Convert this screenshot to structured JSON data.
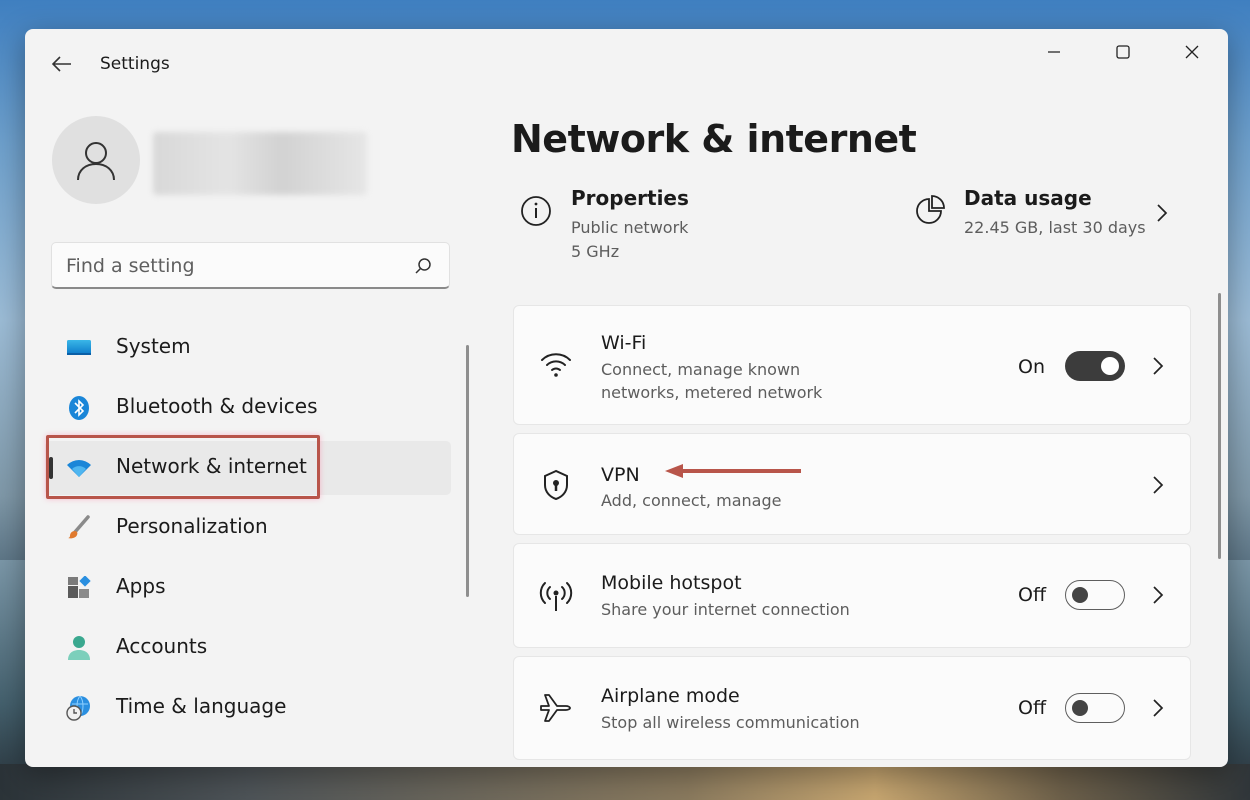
{
  "window": {
    "title": "Settings",
    "controls": [
      "minimize",
      "maximize",
      "close"
    ]
  },
  "user": {
    "avatar_icon": "person-icon"
  },
  "search": {
    "placeholder": "Find a setting"
  },
  "sidebar": {
    "items": [
      {
        "label": "System",
        "icon": "system-icon",
        "selected": false
      },
      {
        "label": "Bluetooth & devices",
        "icon": "bluetooth-icon",
        "selected": false
      },
      {
        "label": "Network & internet",
        "icon": "wifi-icon",
        "selected": true
      },
      {
        "label": "Personalization",
        "icon": "brush-icon",
        "selected": false
      },
      {
        "label": "Apps",
        "icon": "apps-icon",
        "selected": false
      },
      {
        "label": "Accounts",
        "icon": "accounts-icon",
        "selected": false
      },
      {
        "label": "Time & language",
        "icon": "globe-clock-icon",
        "selected": false
      }
    ]
  },
  "main": {
    "title": "Network & internet",
    "properties": {
      "heading": "Properties",
      "line1": "Public network",
      "line2": "5 GHz"
    },
    "data_usage": {
      "heading": "Data usage",
      "detail": "22.45 GB, last 30 days"
    },
    "cards": [
      {
        "title": "Wi-Fi",
        "desc1": "Connect, manage known",
        "desc2": "networks, metered network",
        "state": "On",
        "toggle_on": true,
        "icon": "wifi-icon"
      },
      {
        "title": "VPN",
        "desc1": "Add, connect, manage",
        "icon": "shield-icon"
      },
      {
        "title": "Mobile hotspot",
        "desc1": "Share your internet connection",
        "state": "Off",
        "toggle_on": false,
        "icon": "hotspot-icon"
      },
      {
        "title": "Airplane mode",
        "desc1": "Stop all wireless communication",
        "state": "Off",
        "toggle_on": false,
        "icon": "airplane-icon"
      }
    ]
  },
  "colors": {
    "annotation": "#b8554a",
    "accent": "#0067c0"
  }
}
